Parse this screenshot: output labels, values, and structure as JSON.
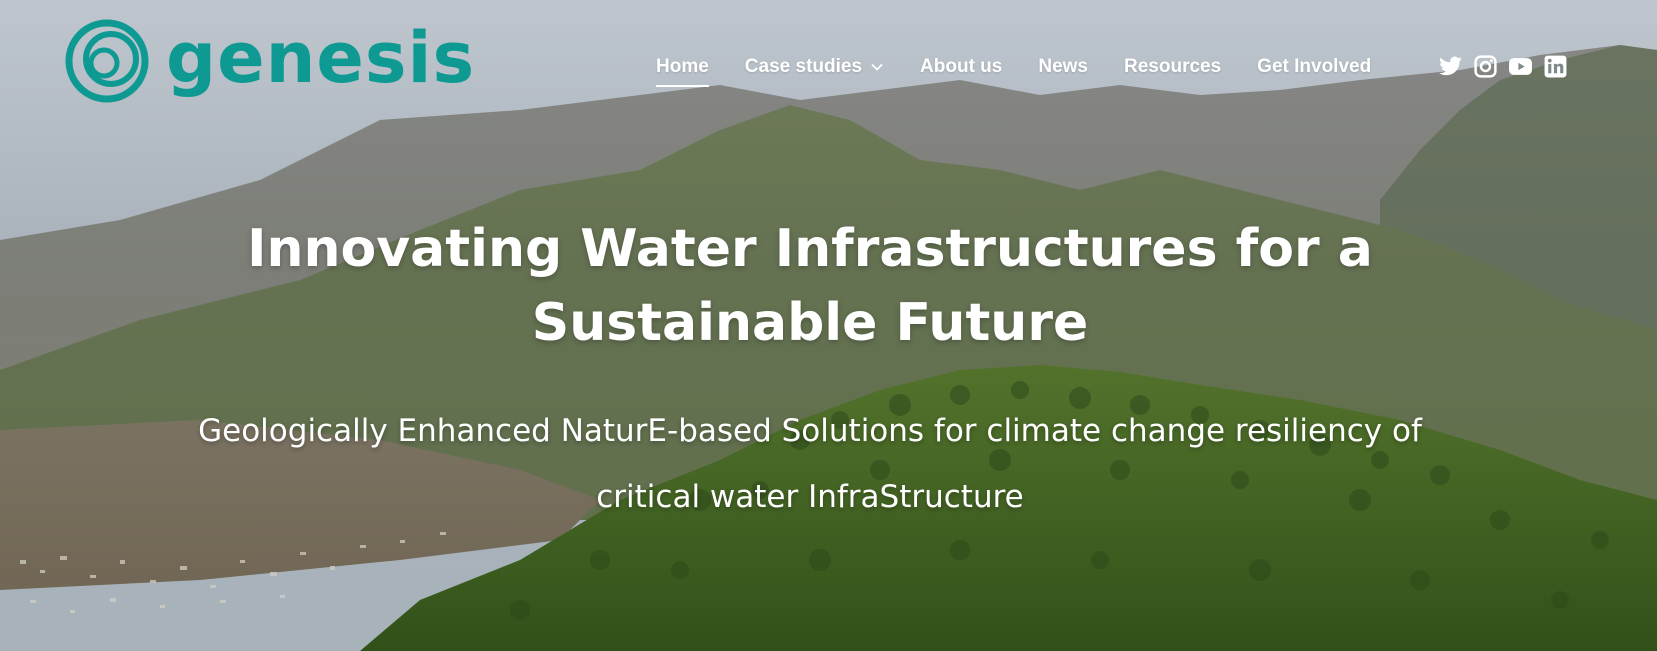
{
  "brand": {
    "name": "genesis",
    "color": "#0e9a93"
  },
  "nav": {
    "items": [
      {
        "label": "Home",
        "active": true
      },
      {
        "label": "Case studies",
        "has_dropdown": true
      },
      {
        "label": "About us"
      },
      {
        "label": "News"
      },
      {
        "label": "Resources"
      },
      {
        "label": "Get Involved"
      }
    ]
  },
  "social": [
    {
      "icon": "twitter-icon"
    },
    {
      "icon": "instagram-icon"
    },
    {
      "icon": "youtube-icon"
    },
    {
      "icon": "linkedin-icon"
    }
  ],
  "hero": {
    "headline_line1": "Innovating Water Infrastructures for a",
    "headline_line2": "Sustainable Future",
    "subtitle_line1": "Geologically Enhanced NaturE-based Solutions for climate change resiliency of",
    "subtitle_line2": "critical water InfraStructure"
  }
}
